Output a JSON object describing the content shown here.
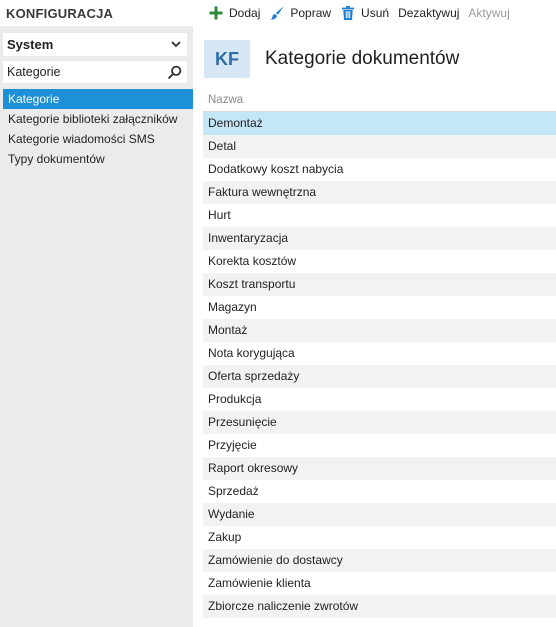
{
  "app": {
    "title": "KONFIGURACJA"
  },
  "toolbar": {
    "add_label": "Dodaj",
    "edit_label": "Popraw",
    "delete_label": "Usuń",
    "deactivate_label": "Dezaktywuj",
    "activate_label": "Aktywuj"
  },
  "sidebar": {
    "module_select": "System",
    "search_value": "Kategorie",
    "items": [
      {
        "label": "Kategorie"
      },
      {
        "label": "Kategorie biblioteki załączników"
      },
      {
        "label": "Kategorie wiadomości SMS"
      },
      {
        "label": "Typy dokumentów"
      }
    ]
  },
  "main": {
    "badge": "KF",
    "title": "Kategorie dokumentów",
    "column_header": "Nazwa",
    "rows": [
      "Demontaż",
      "Detal",
      "Dodatkowy koszt nabycia",
      "Faktura wewnętrzna",
      "Hurt",
      "Inwentaryzacja",
      "Korekta kosztów",
      "Koszt transportu",
      "Magazyn",
      "Montaż",
      "Nota korygująca",
      "Oferta sprzedaży",
      "Produkcja",
      "Przesunięcie",
      "Przyjęcie",
      "Raport okresowy",
      "Sprzedaż",
      "Wydanie",
      "Zakup",
      "Zamówienie do dostawcy",
      "Zamówienie klienta",
      "Zbiorcze naliczenie zwrotów"
    ]
  },
  "colors": {
    "accent": "#1e90d8",
    "selected_row": "#c5e6f6",
    "badge_bg": "#d6e6f4",
    "add_icon": "#2e8b3a",
    "edit_icon": "#1e7fd0",
    "delete_icon": "#1e7fd0"
  }
}
